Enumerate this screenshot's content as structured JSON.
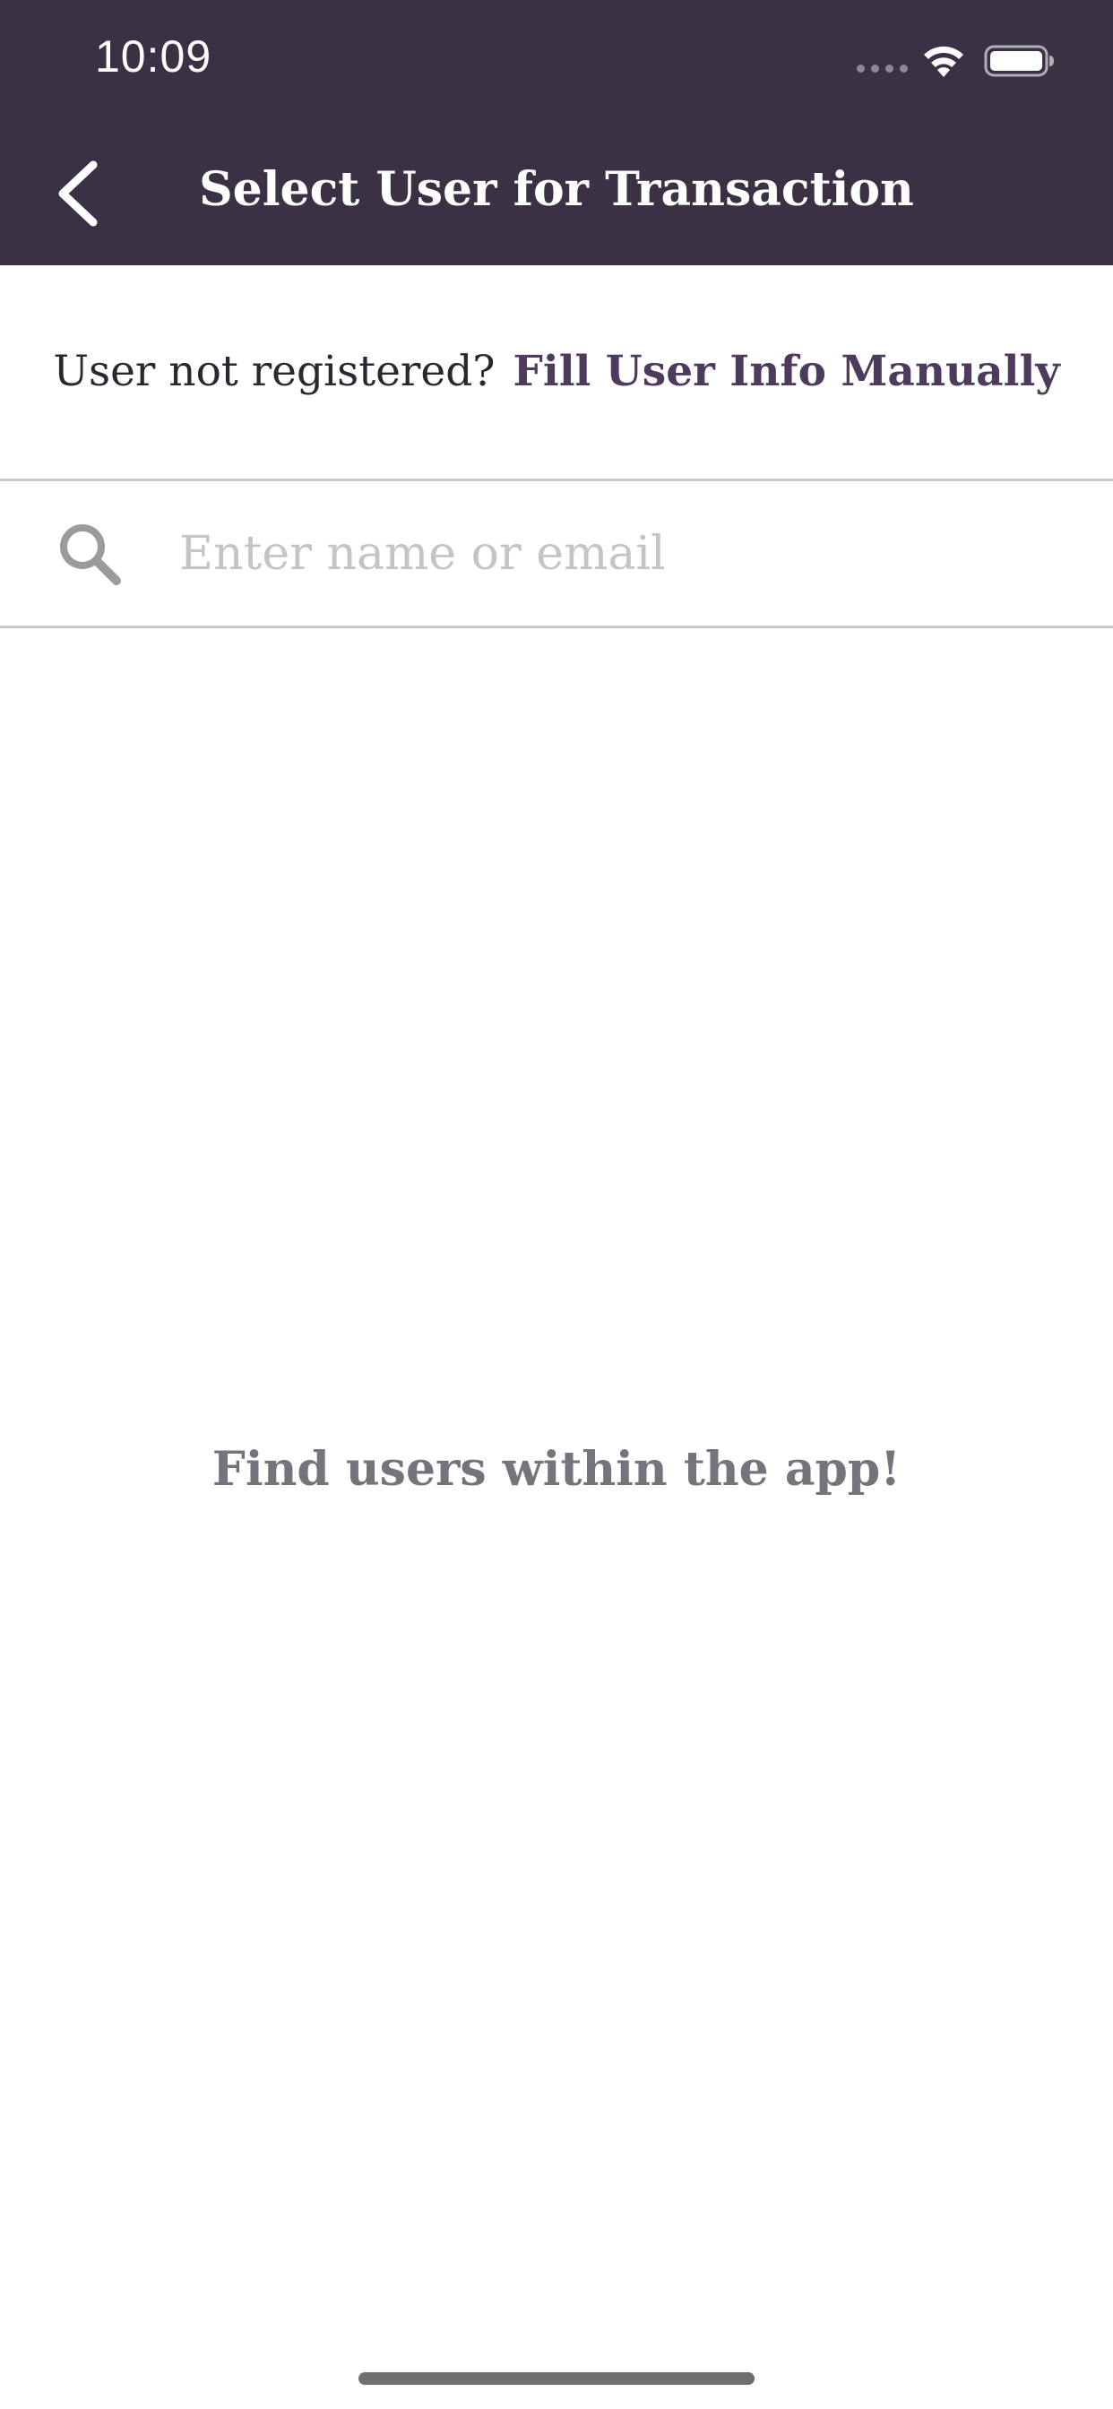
{
  "status_bar": {
    "time": "10:09",
    "wifi_icon": "wifi-icon",
    "battery_icon": "battery-icon"
  },
  "header": {
    "back_icon": "chevron-left-icon",
    "title": "Select User for Transaction",
    "background_color": "#3a3244"
  },
  "register": {
    "question": "User not registered?",
    "link_label": "Fill User Info Manually",
    "link_color": "#4d3a5c"
  },
  "search": {
    "icon": "search-icon",
    "placeholder": "Enter name or email",
    "value": ""
  },
  "empty_state": {
    "message": "Find users within the app!"
  }
}
